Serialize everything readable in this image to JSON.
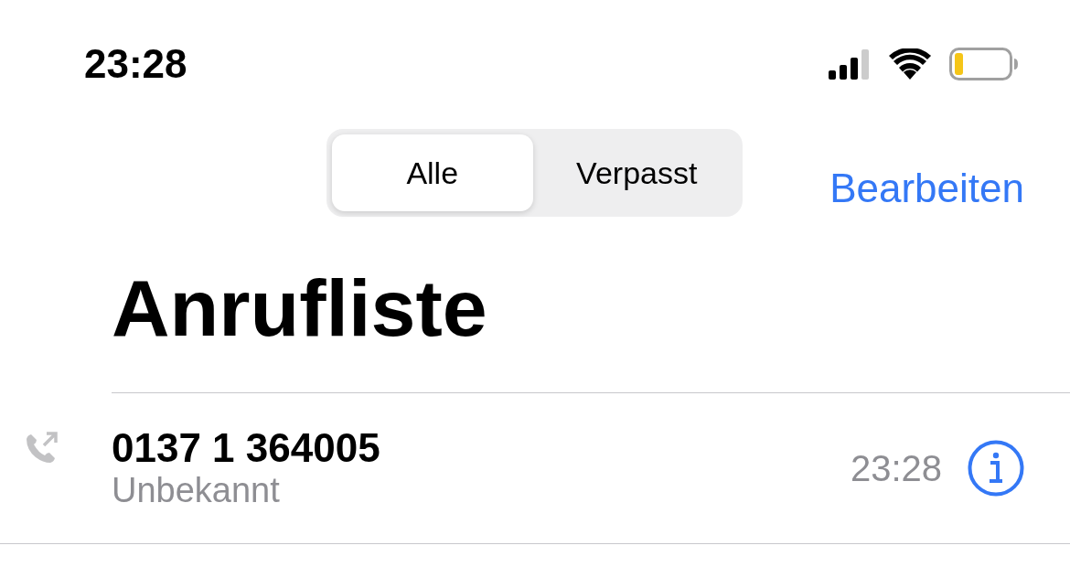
{
  "status_bar": {
    "time": "23:28"
  },
  "segments": [
    {
      "label": "Alle",
      "selected": true
    },
    {
      "label": "Verpasst",
      "selected": false
    }
  ],
  "edit_button": "Bearbeiten",
  "title": "Anrufliste",
  "calls": [
    {
      "number": "0137 1 364005",
      "label": "Unbekannt",
      "time": "23:28",
      "kind": "outgoing"
    }
  ]
}
